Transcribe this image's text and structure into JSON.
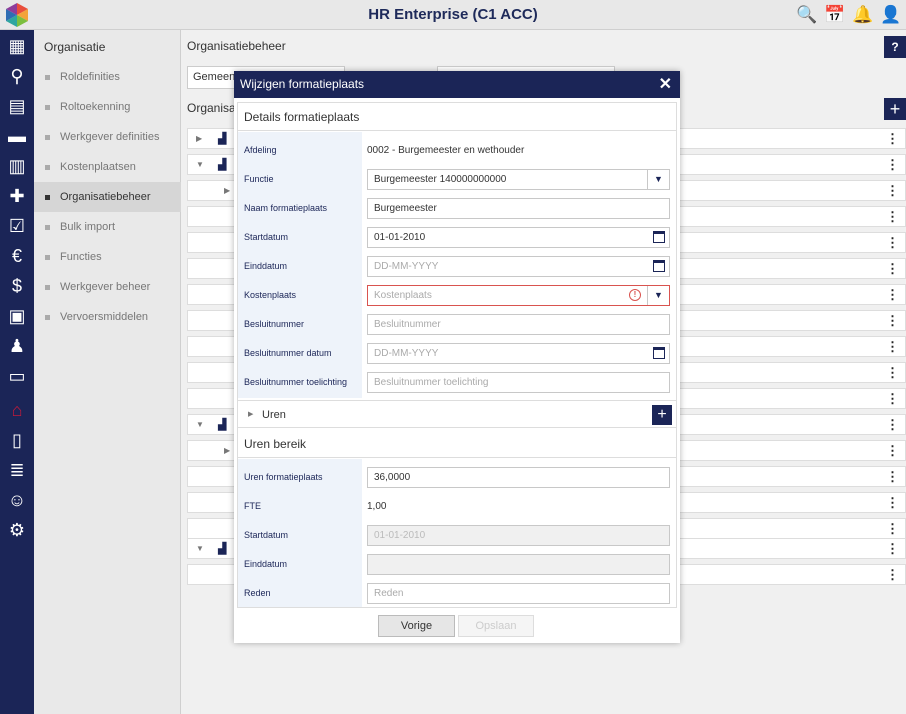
{
  "app": {
    "title": "HR Enterprise (C1 ACC)"
  },
  "topbar": {
    "icons": [
      "search-person-icon",
      "calendar-alert-icon",
      "bell-icon",
      "user-icon"
    ]
  },
  "rail": {
    "items": [
      "dashboard-icon",
      "search-person-icon",
      "id-card-icon",
      "folder-icon",
      "calendar-icon",
      "medical-icon",
      "form-check-icon",
      "money-bag-icon",
      "currency-icon",
      "schedule-icon",
      "person-icon",
      "badge-icon",
      "institution-icon",
      "document-icon",
      "document-list-icon",
      "person-hand-icon",
      "gear-icon"
    ]
  },
  "subnav": {
    "title": "Organisatie",
    "items": [
      {
        "label": "Roldefinities"
      },
      {
        "label": "Roltoekenning"
      },
      {
        "label": "Werkgever definities"
      },
      {
        "label": "Kostenplaatsen"
      },
      {
        "label": "Organisatiebeheer"
      },
      {
        "label": "Bulk import"
      },
      {
        "label": "Functies"
      },
      {
        "label": "Werkgever beheer"
      },
      {
        "label": "Vervoersmiddelen"
      }
    ],
    "active_index": 4
  },
  "main": {
    "title": "Organisatiebeheer",
    "help": "?",
    "select1": "Gemeen",
    "subtitle": "Organisa",
    "add": "+"
  },
  "modal": {
    "title": "Wijzigen formatieplaats",
    "close": "✕",
    "details_title": "Details formatieplaats",
    "fields": {
      "afdeling": {
        "label": "Afdeling",
        "value": "0002 - Burgemeester en wethouder"
      },
      "functie": {
        "label": "Functie",
        "value": "Burgemeester 140000000000"
      },
      "naam": {
        "label": "Naam formatieplaats",
        "value": "Burgemeester"
      },
      "startdatum": {
        "label": "Startdatum",
        "value": "01-01-2010"
      },
      "einddatum": {
        "label": "Einddatum",
        "placeholder": "DD-MM-YYYY"
      },
      "kostenplaats": {
        "label": "Kostenplaats",
        "placeholder": "Kostenplaats"
      },
      "besluitnummer": {
        "label": "Besluitnummer",
        "placeholder": "Besluitnummer"
      },
      "besluit_datum": {
        "label": "Besluitnummer datum",
        "placeholder": "DD-MM-YYYY"
      },
      "besluit_toel": {
        "label": "Besluitnummer toelichting",
        "placeholder": "Besluitnummer toelichting"
      }
    },
    "uren_label": "Uren",
    "uren_add": "+",
    "uren_bereik_title": "Uren bereik",
    "uren_fields": {
      "uren": {
        "label": "Uren formatieplaats",
        "value": "36,0000"
      },
      "fte": {
        "label": "FTE",
        "value": "1,00"
      },
      "startdatum": {
        "label": "Startdatum",
        "value": "01-01-2010"
      },
      "einddatum": {
        "label": "Einddatum",
        "value": ""
      },
      "reden": {
        "label": "Reden",
        "placeholder": "Reden"
      }
    },
    "buttons": {
      "prev": "Vorige",
      "save": "Opslaan"
    }
  },
  "colors": {
    "navy": "#1b2557",
    "accent": "#c21a3a",
    "error": "#d9534f"
  }
}
